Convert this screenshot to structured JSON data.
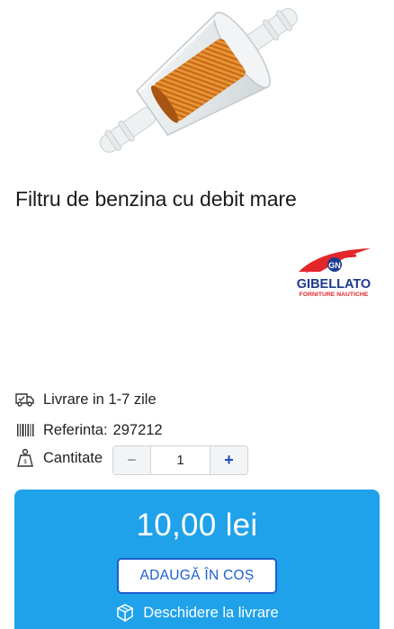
{
  "product": {
    "title": "Filtru de benzina cu debit mare",
    "image_alt": "fuel filter"
  },
  "brand": {
    "name": "GIBELLATO",
    "tagline": "FORNITURE NAUTICHE",
    "mark": "GN",
    "color": "#e3262b",
    "secondary_color": "#1d3a8f"
  },
  "info": {
    "delivery": "Livrare in 1-7 zile",
    "reference_label": "Referinta:",
    "reference_value": "297212",
    "quantity_label": "Cantitate",
    "quantity_value": "1",
    "minus": "−",
    "plus": "+"
  },
  "buy": {
    "price": "10,00 lei",
    "add_to_cart": "ADAUGĂ ÎN COȘ",
    "open_delivery": "Deschidere la livrare",
    "background": "#1fa2ea",
    "button_color": "#1b5fd0"
  }
}
